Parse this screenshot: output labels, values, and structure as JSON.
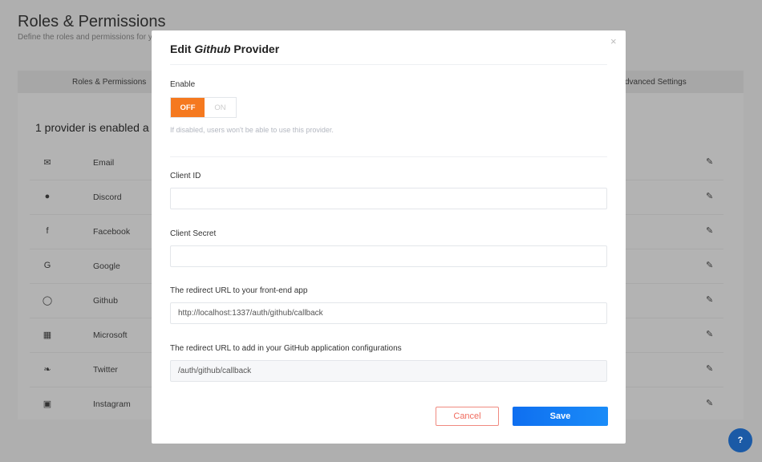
{
  "page": {
    "title": "Roles & Permissions",
    "subtitle": "Define the roles and permissions for y"
  },
  "tabs": [
    {
      "label": "Roles & Permissions"
    },
    {
      "label": "dvanced Settings"
    }
  ],
  "card": {
    "heading": "1 provider is enabled a"
  },
  "providers": [
    {
      "label": "Email",
      "icon": "✉"
    },
    {
      "label": "Discord",
      "icon": "●"
    },
    {
      "label": "Facebook",
      "icon": "f"
    },
    {
      "label": "Google",
      "icon": "G"
    },
    {
      "label": "Github",
      "icon": "◯"
    },
    {
      "label": "Microsoft",
      "icon": "▦"
    },
    {
      "label": "Twitter",
      "icon": "❧"
    },
    {
      "label": "Instagram",
      "icon": "▣"
    }
  ],
  "edit_icon": "✎",
  "modal": {
    "title_prefix": "Edit ",
    "title_name": "Github",
    "title_suffix": " Provider",
    "close": "×",
    "enable_label": "Enable",
    "toggle": {
      "off": "OFF",
      "on": "ON",
      "state": "off"
    },
    "enable_help": "If disabled, users won't be able to use this provider.",
    "client_id_label": "Client ID",
    "client_id_value": "",
    "client_secret_label": "Client Secret",
    "client_secret_value": "",
    "redirect_front_label": "The redirect URL to your front-end app",
    "redirect_front_value": "http://localhost:1337/auth/github/callback",
    "redirect_app_label": "The redirect URL to add in your GitHub application configurations",
    "redirect_app_value": "/auth/github/callback",
    "cancel": "Cancel",
    "save": "Save"
  },
  "help_button": "?",
  "colors": {
    "accent_orange": "#f5791f",
    "primary_blue": "#0f6ff0",
    "cancel_red": "#f06b5e"
  }
}
